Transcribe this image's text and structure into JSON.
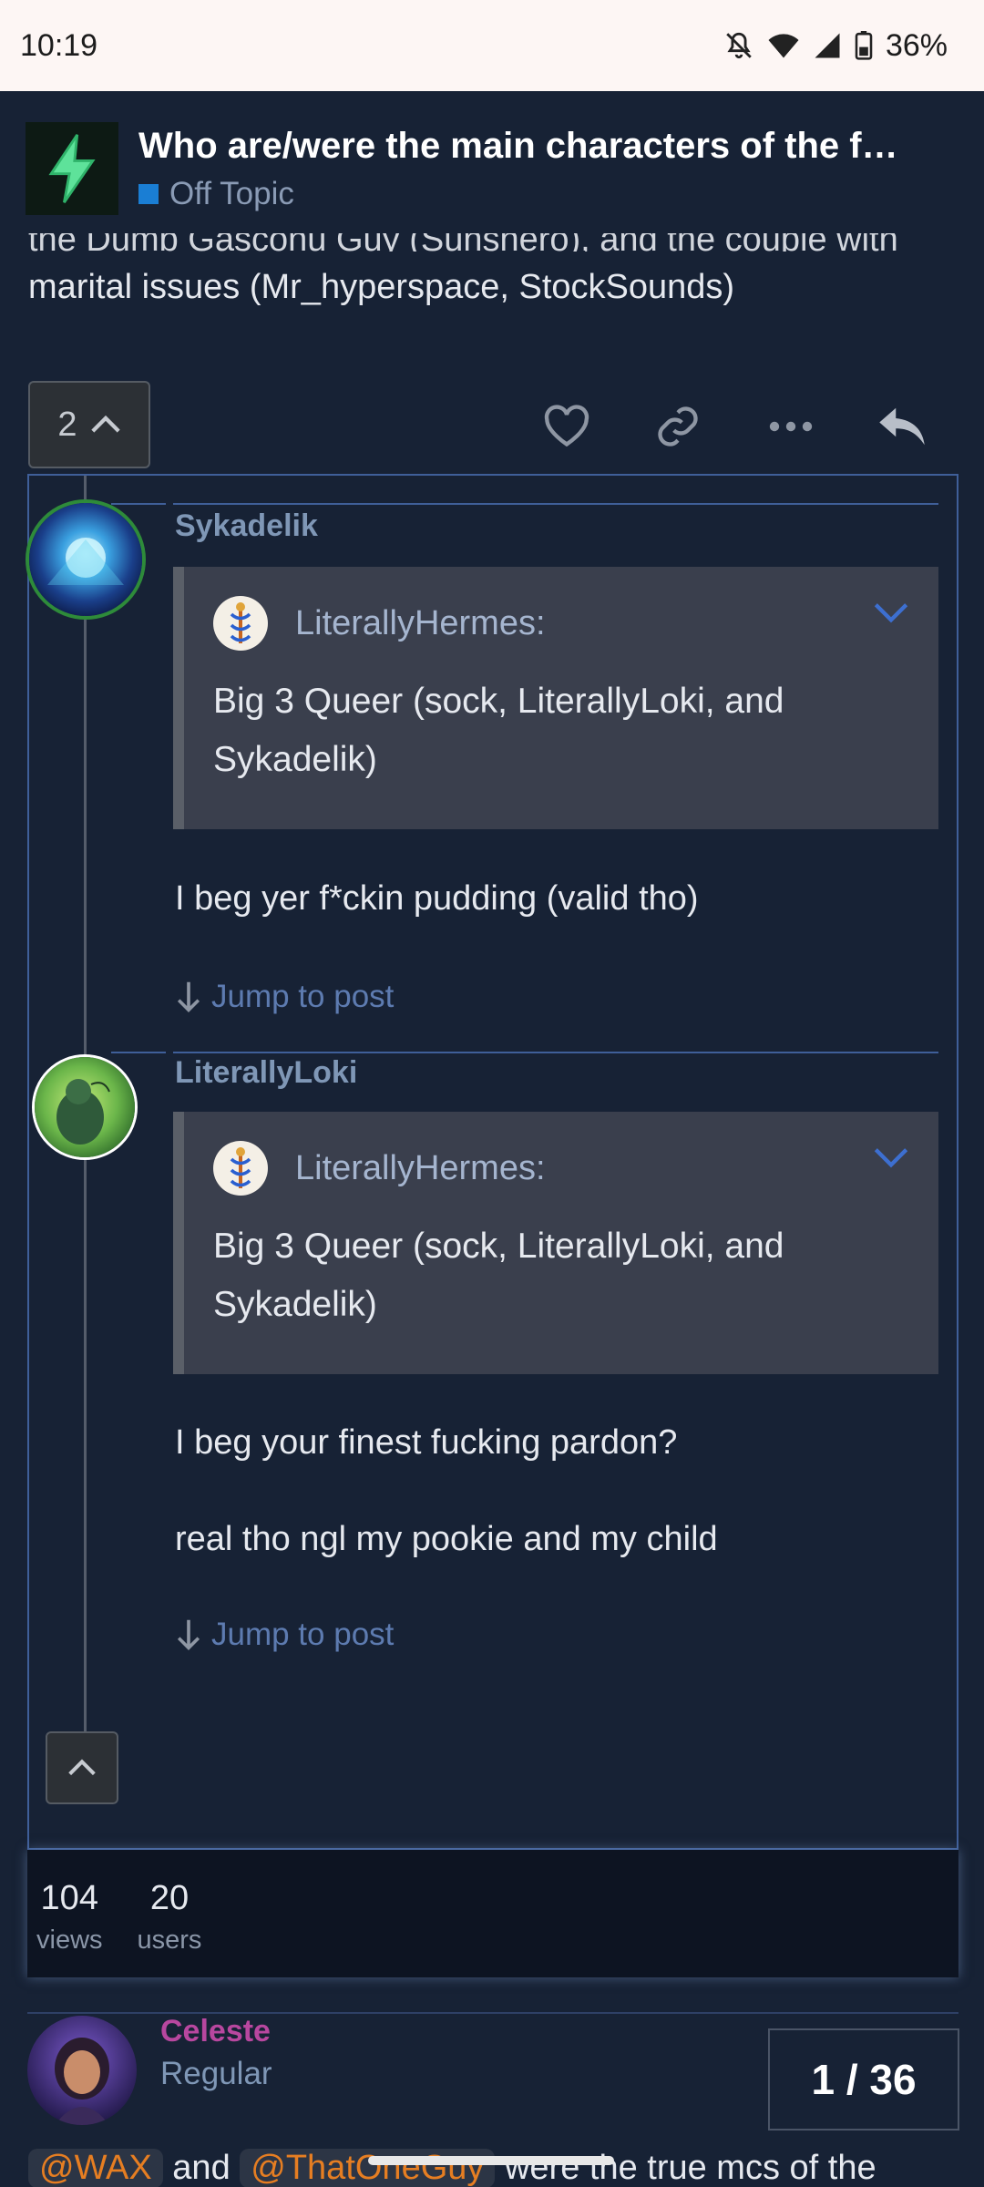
{
  "status_bar": {
    "time": "10:19",
    "battery": "36%"
  },
  "topic": {
    "title": "Who are/were the main characters of the f…",
    "category": "Off Topic",
    "category_color": "#1a7ed4"
  },
  "previous_post": {
    "text_line1": "the Dumb Gasconu Guy (Sunshero), and the couple with",
    "text_line2": "marital issues (Mr_hyperspace, StockSounds)"
  },
  "actions": {
    "reply_count": "2",
    "icons": [
      "heart-icon",
      "link-icon",
      "more-icon",
      "reply-icon"
    ]
  },
  "replies": [
    {
      "username": "Sykadelik",
      "quote_user": "LiterallyHermes:",
      "quote_text": "Big 3 Queer (sock, LiterallyLoki, and Sykadelik)",
      "body": [
        "I beg yer f*ckin pudding (valid tho)"
      ],
      "jump_label": "Jump to post"
    },
    {
      "username": "LiterallyLoki",
      "quote_user": "LiterallyHermes:",
      "quote_text": "Big 3 Queer (sock, LiterallyLoki, and Sykadelik)",
      "body": [
        "I beg your finest fucking pardon?",
        "real tho ngl my pookie and my child"
      ],
      "jump_label": "Jump to post"
    }
  ],
  "stats": {
    "views": "104",
    "views_label": "views",
    "users": "20",
    "users_label": "users"
  },
  "next_post": {
    "username": "Celeste",
    "user_title": "Regular",
    "mention1": "@WAX",
    "connector": "and",
    "mention2": "@ThatOneGuy",
    "text": "were the true mcs of the"
  },
  "progress": "1 / 36",
  "colors": {
    "accent": "#3f5f99",
    "background": "#172235",
    "mention": "#e67e22"
  }
}
